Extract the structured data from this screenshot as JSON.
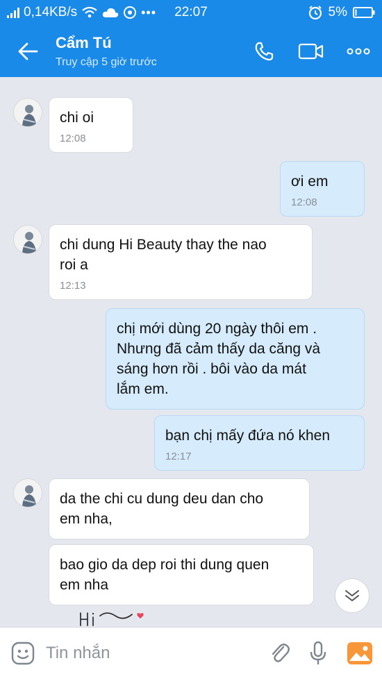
{
  "status_bar": {
    "network_speed": "0,14KB/s",
    "time": "22:07",
    "battery": "5%"
  },
  "header": {
    "contact_name": "Cẩm Tú",
    "last_seen": "Truy cập 5 giờ trước"
  },
  "messages": [
    {
      "direction": "in",
      "text": "chi oi",
      "time": "12:08"
    },
    {
      "direction": "out",
      "text": "ơi em",
      "time": "12:08"
    },
    {
      "direction": "in",
      "lines": [
        "chi dung Hi Beauty thay the nao",
        "roi a"
      ],
      "time": "12:13"
    },
    {
      "direction": "out",
      "lines": [
        "chị mới dùng 20 ngày thôi em .",
        "Nhưng đã cảm thấy da căng và",
        "sáng  hơn rồi . bôi vào da mát",
        "lắm em."
      ]
    },
    {
      "direction": "out",
      "text": "bạn chị mấy đứa nó khen",
      "time": "12:17"
    },
    {
      "direction": "in",
      "lines": [
        "da the chi cu dung deu dan cho",
        "em nha,"
      ]
    },
    {
      "direction": "in",
      "lines": [
        "bao gio da dep roi thi dung quen",
        "em nha"
      ]
    }
  ],
  "input": {
    "placeholder": "Tin nhắn"
  },
  "icons": {
    "back": "arrow-left-icon",
    "call": "phone-icon",
    "video": "video-camera-icon",
    "more": "more-dots-icon",
    "emoji": "emoji-icon",
    "attach": "paperclip-icon",
    "voice": "microphone-icon",
    "image": "image-icon",
    "scroll": "chevron-double-down-icon",
    "sticker": "hi-sticker-icon"
  },
  "colors": {
    "header": "#1a8ae8",
    "chat_bg": "#e4e8ee",
    "out_bubble": "#d6ecfc",
    "in_bubble": "#ffffff",
    "image_icon": "#f7973a"
  }
}
